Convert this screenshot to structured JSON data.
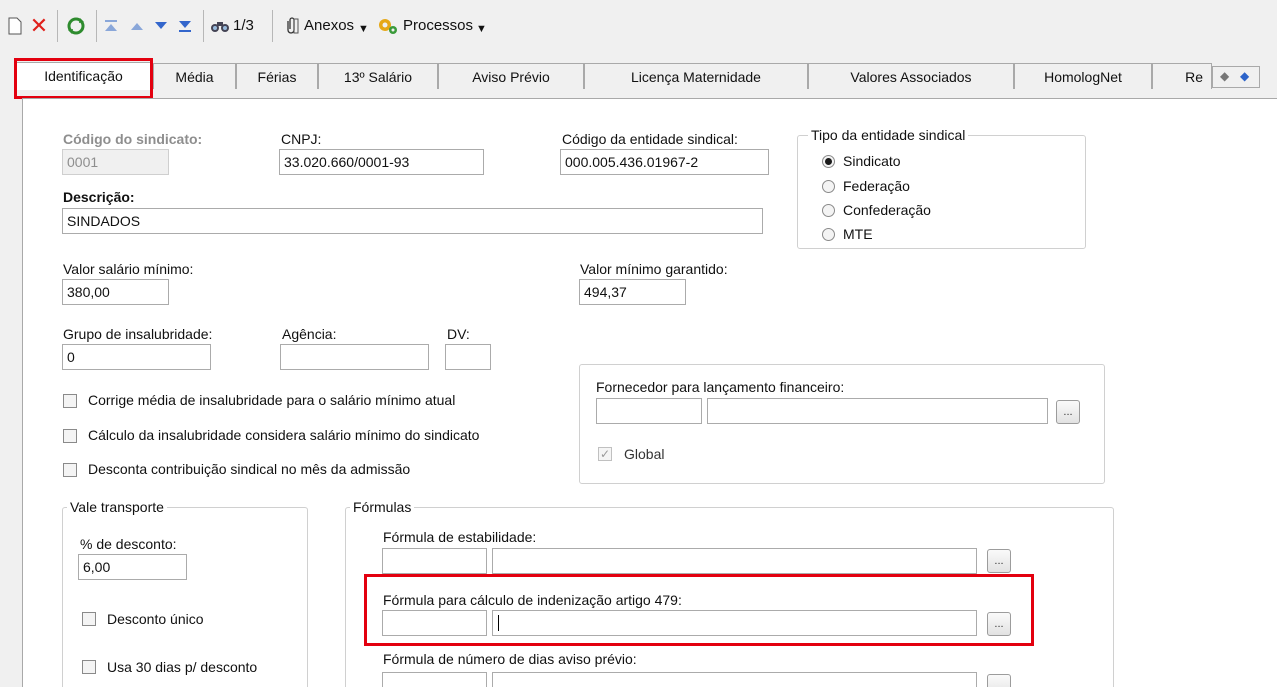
{
  "toolbar": {
    "record_position": "1/3",
    "attachments_label": "Anexos",
    "processes_label": "Processos"
  },
  "tabs": [
    "Identificação",
    "Média",
    "Férias",
    "13º Salário",
    "Aviso Prévio",
    "Licença Maternidade",
    "Valores Associados",
    "HomologNet",
    "Re"
  ],
  "form": {
    "codigo_sindicato": {
      "label": "Código do sindicato:",
      "value": "0001"
    },
    "cnpj": {
      "label": "CNPJ:",
      "value": "33.020.660/0001-93"
    },
    "codigo_entidade": {
      "label": "Código da entidade sindical:",
      "value": "000.005.436.01967-2"
    },
    "tipo_entidade": {
      "title": "Tipo da entidade sindical",
      "options": [
        "Sindicato",
        "Federação",
        "Confederação",
        "MTE"
      ],
      "selected": "Sindicato"
    },
    "descricao": {
      "label": "Descrição:",
      "value": "SINDADOS"
    },
    "valor_salario_minimo": {
      "label": "Valor salário mínimo:",
      "value": "380,00"
    },
    "valor_minimo_garantido": {
      "label": "Valor mínimo garantido:",
      "value": "494,37"
    },
    "grupo_insalubridade": {
      "label": "Grupo de insalubridade:",
      "value": "0"
    },
    "agencia": {
      "label": "Agência:",
      "value": ""
    },
    "dv": {
      "label": "DV:",
      "value": ""
    },
    "checkboxes": [
      {
        "label": "Corrige média de insalubridade para o salário mínimo atual",
        "checked": false
      },
      {
        "label": "Cálculo da insalubridade considera salário mínimo do sindicato",
        "checked": false
      },
      {
        "label": "Desconta contribuição sindical no mês da admissão",
        "checked": false
      }
    ],
    "fornecedor": {
      "label": "Fornecedor para lançamento financeiro:",
      "global_label": "Global",
      "global_checked": true
    },
    "vale_transporte": {
      "title": "Vale transporte",
      "desconto_label": "% de desconto:",
      "desconto_value": "6,00",
      "desconto_unico_label": "Desconto único",
      "usa_30_dias_label": "Usa 30 dias p/ desconto"
    },
    "formulas": {
      "title": "Fórmulas",
      "estabilidade_label": "Fórmula de estabilidade:",
      "indenizacao_label": "Fórmula para cálculo de indenização artigo 479:",
      "aviso_previo_label": "Fórmula de número de dias aviso prévio:"
    },
    "ellipsis": "..."
  },
  "colors": {
    "highlight": "#e3000f",
    "window_bg": "#f0f0f0",
    "panel_bg": "#ffffff"
  }
}
